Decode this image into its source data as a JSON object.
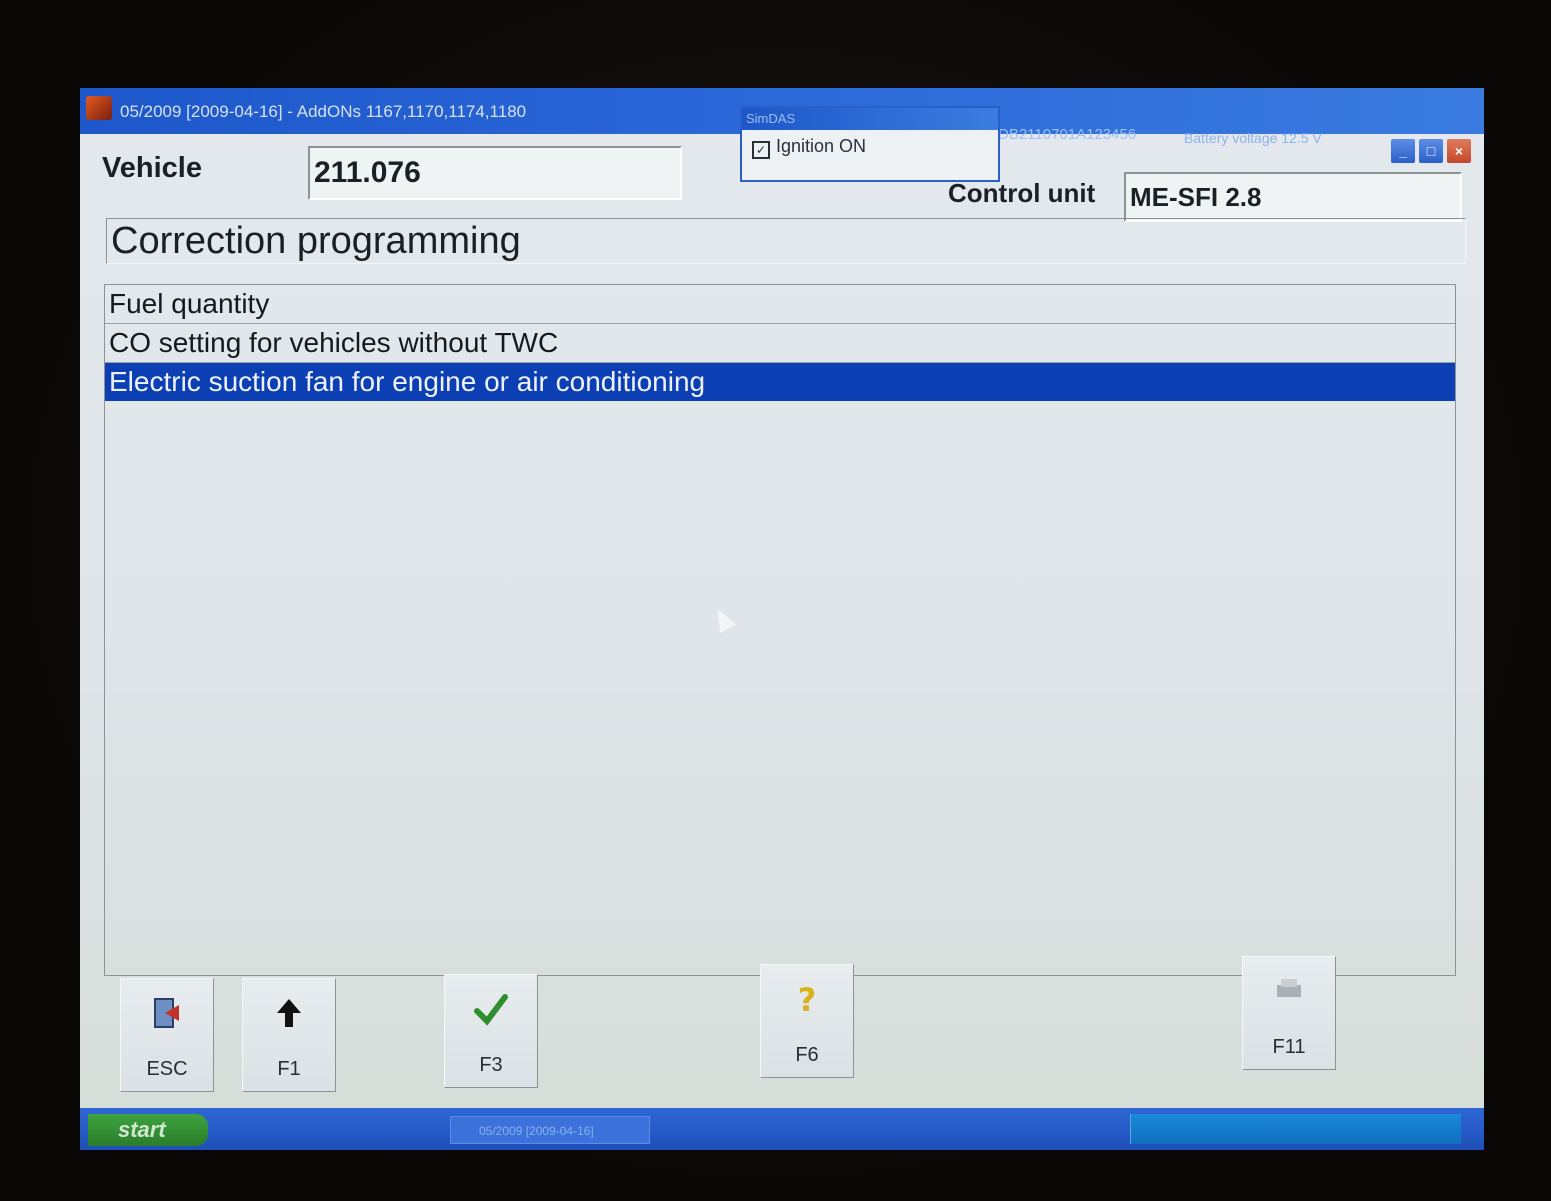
{
  "window": {
    "title": "05/2009 [2009-04-16] - AddONs  1167,1170,1174,1180",
    "vin": "DB2110701A123456",
    "battery_label": "Battery voltage  12.5 V"
  },
  "popup": {
    "title": "SimDAS",
    "checkbox_label": "Ignition ON",
    "checked": true
  },
  "header": {
    "vehicle_label": "Vehicle",
    "vehicle_value": "211.076",
    "control_unit_label": "Control unit",
    "control_unit_value": "ME-SFI 2.8"
  },
  "section_title": "Correction programming",
  "list": {
    "items": [
      "Fuel quantity",
      "CO setting for vehicles without TWC",
      "Electric suction fan for engine or air conditioning"
    ],
    "selected_index": 2
  },
  "fkeys": [
    {
      "label": "ESC",
      "icon": "exit-door-icon"
    },
    {
      "label": "F1",
      "icon": "arrow-up-icon"
    },
    {
      "label": "F3",
      "icon": "checkmark-icon"
    },
    {
      "label": "F6",
      "icon": "help-question-icon"
    },
    {
      "label": "F11",
      "icon": "printer-icon"
    }
  ],
  "taskbar": {
    "start_label": "start",
    "task_label": "05/2009 [2009-04-16]"
  },
  "colors": {
    "titlebar": "#1d57c9",
    "selection": "#0c3fb3",
    "checkmark": "#2f8f2f",
    "help": "#d9b21c"
  }
}
